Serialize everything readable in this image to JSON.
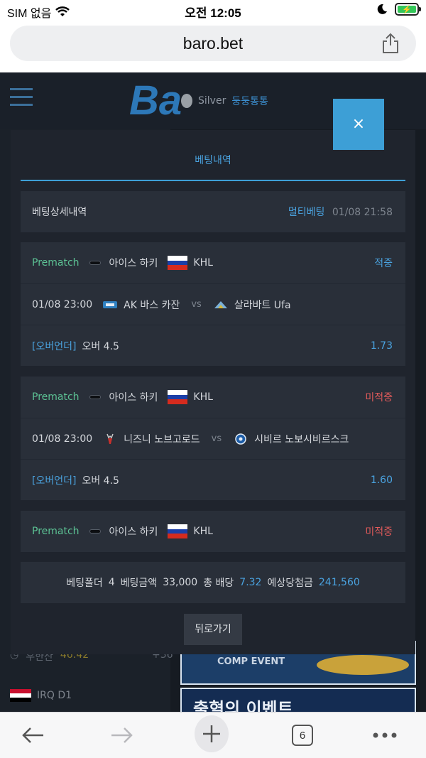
{
  "status_bar": {
    "carrier": "SIM 없음",
    "time": "오전 12:05",
    "battery_level": 0.95
  },
  "browser": {
    "url": "baro.bet",
    "tab_count": "6"
  },
  "background": {
    "logo_text": "Ba",
    "tier": "Silver",
    "nickname": "둥둥통통",
    "score_row": {
      "label": "우한산",
      "time": "46:42",
      "extra": "+36"
    },
    "league": "IRQ D1",
    "banner1_text": "COMP EVENT",
    "banner2_text": "출혈의 이벤트"
  },
  "modal": {
    "close_label": "×",
    "tab_label": "베팅내역",
    "detail": {
      "title": "베팅상세내역",
      "type": "멀티베팅",
      "datetime": "01/08 21:58"
    },
    "bets": [
      {
        "market_type": "Prematch",
        "sport": "아이스 하키",
        "league": "KHL",
        "result": "적중",
        "result_class": "hit",
        "match_time": "01/08 23:00",
        "home": "AK 바스 카잔",
        "vs": "vs",
        "away": "살라바트 Ufa",
        "pick_market": "[오버언더]",
        "pick": "오버 4.5",
        "odds": "1.73"
      },
      {
        "market_type": "Prematch",
        "sport": "아이스 하키",
        "league": "KHL",
        "result": "미적중",
        "result_class": "miss",
        "match_time": "01/08 23:00",
        "home": "니즈니 노브고로드",
        "vs": "vs",
        "away": "시비르 노보시비르스크",
        "pick_market": "[오버언더]",
        "pick": "오버 4.5",
        "odds": "1.60"
      },
      {
        "market_type": "Prematch",
        "sport": "아이스 하키",
        "league": "KHL",
        "result": "미적중",
        "result_class": "miss"
      }
    ],
    "summary": {
      "folders_label": "베팅폴더",
      "folders": "4",
      "amount_label": "베팅금액",
      "amount": "33,000",
      "total_odds_label": "총 배당",
      "total_odds": "7.32",
      "payout_label": "예상당첨금",
      "payout": "241,560"
    },
    "back_label": "뒤로가기"
  },
  "colors": {
    "accent": "#3d9fd6",
    "prematch": "#5cc294",
    "miss": "#e35b5b",
    "modal_bg": "#1f242d",
    "card_bg": "#292f39"
  }
}
